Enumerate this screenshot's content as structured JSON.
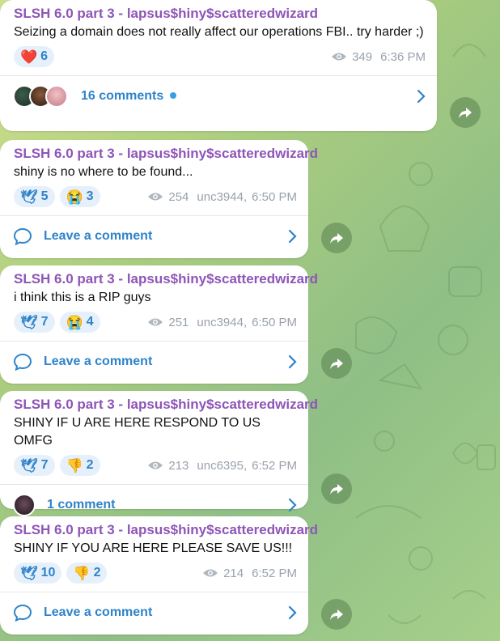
{
  "messages": [
    {
      "author": "SLSH 6.0 part 3 - lapsus$hiny$scatteredwizard",
      "text": "Seizing a domain does not really affect our operations FBI.. try harder ;)",
      "reactions": [
        {
          "emoji": "❤️",
          "icon": "heart-icon",
          "count": "6"
        }
      ],
      "views": "349",
      "signature": "",
      "time": "6:36 PM",
      "comment_label": "16 comments",
      "comment_type": "avatars"
    },
    {
      "author": "SLSH 6.0 part 3 - lapsus$hiny$scatteredwizard",
      "text": "shiny is no where to be found...",
      "reactions": [
        {
          "emoji": "🕊",
          "icon": "dove-icon",
          "count": "5"
        },
        {
          "emoji": "😭",
          "icon": "crying-face-icon",
          "count": "3"
        }
      ],
      "views": "254",
      "signature": "unc3944,",
      "time": "6:50 PM",
      "comment_label": "Leave a comment",
      "comment_type": "bubble"
    },
    {
      "author": "SLSH 6.0 part 3 - lapsus$hiny$scatteredwizard",
      "text": "i think this is a RIP guys",
      "reactions": [
        {
          "emoji": "🕊",
          "icon": "dove-icon",
          "count": "7"
        },
        {
          "emoji": "😭",
          "icon": "crying-face-icon",
          "count": "4"
        }
      ],
      "views": "251",
      "signature": "unc3944,",
      "time": "6:50 PM",
      "comment_label": "Leave a comment",
      "comment_type": "bubble"
    },
    {
      "author": "SLSH 6.0 part 3 - lapsus$hiny$scatteredwizard",
      "text": "SHINY IF U ARE HERE RESPOND TO US OMFG",
      "reactions": [
        {
          "emoji": "🕊",
          "icon": "dove-icon",
          "count": "7"
        },
        {
          "emoji": "👎",
          "icon": "thumbs-down-icon",
          "count": "2"
        }
      ],
      "views": "213",
      "signature": "unc6395,",
      "time": "6:52 PM",
      "comment_label": "1 comment",
      "comment_type": "avatar-single"
    },
    {
      "author": "SLSH 6.0 part 3 - lapsus$hiny$scatteredwizard",
      "text": "SHINY IF YOU ARE HERE PLEASE SAVE US!!!",
      "reactions": [
        {
          "emoji": "🕊",
          "icon": "dove-icon",
          "count": "10"
        },
        {
          "emoji": "👎",
          "icon": "thumbs-down-icon",
          "count": "2"
        }
      ],
      "views": "214",
      "signature": "",
      "time": "6:52 PM",
      "comment_label": "Leave a comment",
      "comment_type": "bubble"
    }
  ],
  "colors": {
    "author": "#8e55b8",
    "accent": "#2f83c9",
    "reaction_bg": "#e6f0fb",
    "meta": "#9aa2ab"
  }
}
